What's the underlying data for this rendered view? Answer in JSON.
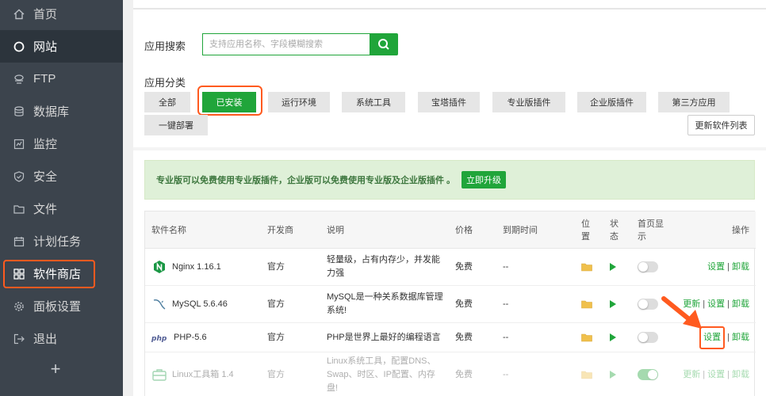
{
  "sidebar": {
    "items": [
      {
        "label": "首页",
        "icon": "home-icon"
      },
      {
        "label": "网站",
        "icon": "globe-icon"
      },
      {
        "label": "FTP",
        "icon": "ftp-icon"
      },
      {
        "label": "数据库",
        "icon": "database-icon"
      },
      {
        "label": "监控",
        "icon": "monitor-icon"
      },
      {
        "label": "安全",
        "icon": "shield-icon"
      },
      {
        "label": "文件",
        "icon": "folder-icon"
      },
      {
        "label": "计划任务",
        "icon": "calendar-icon"
      },
      {
        "label": "软件商店",
        "icon": "apps-icon"
      },
      {
        "label": "面板设置",
        "icon": "gear-icon"
      },
      {
        "label": "退出",
        "icon": "logout-icon"
      }
    ],
    "add_label": "+"
  },
  "search": {
    "label": "应用搜索",
    "placeholder": "支持应用名称、字段模糊搜索"
  },
  "category": {
    "label": "应用分类",
    "items": [
      "全部",
      "已安装",
      "运行环境",
      "系统工具",
      "宝塔插件",
      "专业版插件",
      "企业版插件",
      "第三方应用",
      "一键部署"
    ],
    "selected": "已安装",
    "refresh_label": "更新软件列表"
  },
  "notice": {
    "text": "专业版可以免费使用专业版插件，企业版可以免费使用专业版及企业版插件 。",
    "upgrade_label": "立即升级"
  },
  "table": {
    "headers": {
      "name": "软件名称",
      "developer": "开发商",
      "desc": "说明",
      "price": "价格",
      "expire": "到期时间",
      "location_a": "位",
      "location_b": "置",
      "status_a": "状",
      "status_b": "态",
      "home_a": "首页显",
      "home_b": "示",
      "action": "操作"
    },
    "rows": [
      {
        "name": "Nginx 1.16.1",
        "developer": "官方",
        "desc": "轻量级，占有内存少，并发能力强",
        "price": "免费",
        "expire": "--",
        "home": false,
        "actions": [
          "设置",
          "卸载"
        ]
      },
      {
        "name": "MySQL 5.6.46",
        "developer": "官方",
        "desc": "MySQL是一种关系数据库管理系统!",
        "price": "免费",
        "expire": "--",
        "home": false,
        "actions": [
          "更新",
          "设置",
          "卸载"
        ]
      },
      {
        "name": "PHP-5.6",
        "developer": "官方",
        "desc": "PHP是世界上最好的编程语言",
        "price": "免费",
        "expire": "--",
        "home": false,
        "actions": [
          "设置",
          "卸载"
        ]
      },
      {
        "name": "Linux工具箱 1.4",
        "developer": "官方",
        "desc": "Linux系统工具，配置DNS、Swap、时区、IP配置、内存盘!",
        "price": "免费",
        "expire": "--",
        "home": true,
        "actions": [
          "更新",
          "设置",
          "卸载"
        ]
      }
    ]
  },
  "colors": {
    "accent": "#20a53a",
    "highlight": "#ff5a1f",
    "sidebar_bg": "#3c444d"
  }
}
